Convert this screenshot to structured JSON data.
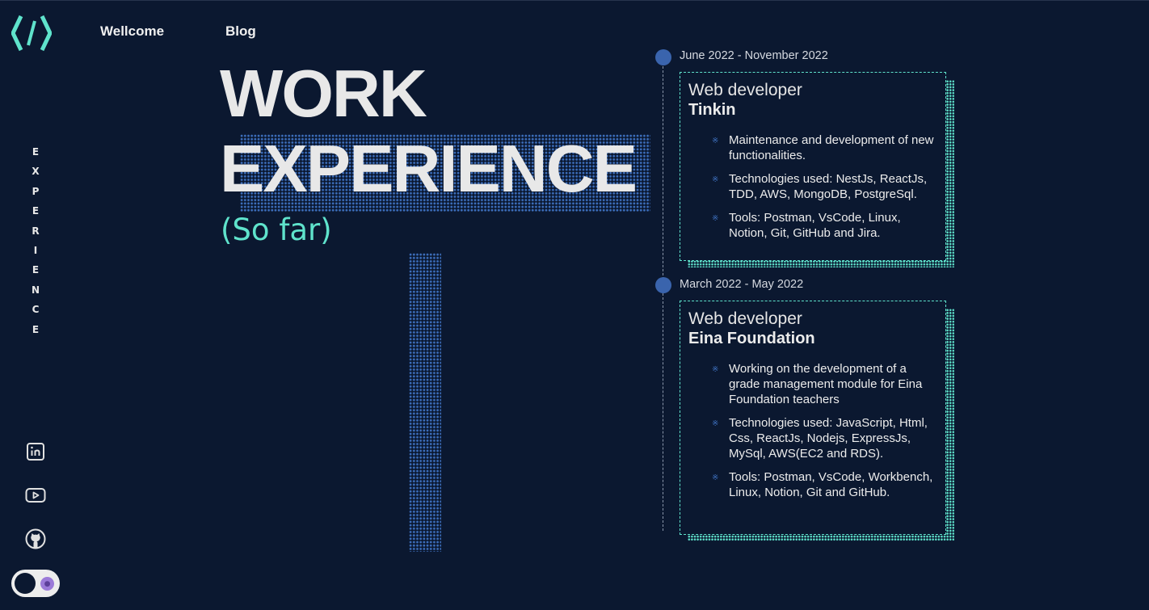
{
  "nav": {
    "items": [
      {
        "label": "Wellcome"
      },
      {
        "label": "Blog"
      }
    ]
  },
  "sidebar": {
    "vertical_label": [
      "E",
      "X",
      "P",
      "E",
      "R",
      "I",
      "E",
      "N",
      "C",
      "E"
    ],
    "social": [
      {
        "icon": "linkedin-icon"
      },
      {
        "icon": "youtube-icon"
      },
      {
        "icon": "github-icon"
      }
    ],
    "theme_toggle": {
      "icon": "moon-icon"
    }
  },
  "heading": {
    "line1": "WORK",
    "line2": "EXPERIENCE",
    "subtitle": "(So far)"
  },
  "timeline": [
    {
      "date": "June 2022 - November 2022",
      "role": "Web developer",
      "company": "Tinkin",
      "bullets": [
        "Maintenance and development of new functionalities.",
        "Technologies used: NestJs, ReactJs, TDD, AWS, MongoDB, PostgreSql.",
        "Tools: Postman, VsCode, Linux, Notion, Git, GitHub and Jira."
      ]
    },
    {
      "date": "March 2022 - May 2022",
      "role": "Web developer",
      "company": "Eina Foundation",
      "bullets": [
        "Working on the development of a grade management module for Eina Foundation teachers",
        "Technologies used: JavaScript, Html, Css, ReactJs, Nodejs, ExpressJs, MySql, AWS(EC2 and RDS).",
        "Tools: Postman, VsCode, Workbench, Linux, Notion, Git and GitHub."
      ]
    }
  ],
  "colors": {
    "background": "#0b1830",
    "accent": "#5fe3cc",
    "dots": "#3d6fbd",
    "timeline_dot": "#3a64ad"
  }
}
